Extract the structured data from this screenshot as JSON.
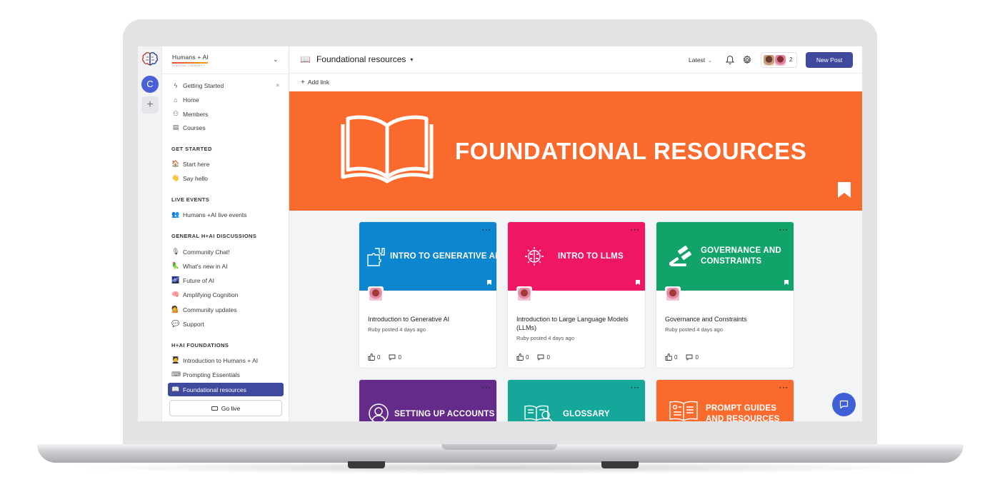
{
  "sidebar": {
    "brand": {
      "name": "Humans + AI",
      "tagline": "LEARNING COMMUNITY"
    },
    "rail": {
      "avatar_letter": "C",
      "add_label": "+"
    },
    "top_items": [
      {
        "label": "Getting Started",
        "icon": "lightning-icon",
        "close": "×"
      },
      {
        "label": "Home",
        "icon": "home-icon"
      },
      {
        "label": "Members",
        "icon": "users-icon"
      },
      {
        "label": "Courses",
        "icon": "book-icon"
      }
    ],
    "sections": [
      {
        "title": "GET STARTED",
        "items": [
          {
            "label": "Start here",
            "emoji": "🏠"
          },
          {
            "label": "Say hello",
            "emoji": "👋"
          }
        ]
      },
      {
        "title": "LIVE EVENTS",
        "items": [
          {
            "label": "Humans +AI live events",
            "emoji": "👥"
          }
        ]
      },
      {
        "title": "GENERAL H+AI DISCUSSIONS",
        "items": [
          {
            "label": "Community Chat!",
            "emoji": "🎙"
          },
          {
            "label": "What's new in AI",
            "emoji": "🦜"
          },
          {
            "label": "Future of AI",
            "emoji": "🌌"
          },
          {
            "label": "Amplifying Cognition",
            "emoji": "🧠"
          },
          {
            "label": "Community updates",
            "emoji": "💁"
          },
          {
            "label": "Support",
            "emoji": "💬"
          }
        ]
      },
      {
        "title": "H+AI FOUNDATIONS",
        "items": [
          {
            "label": "Introduction to Humans + AI",
            "emoji": "🧑‍🎓"
          },
          {
            "label": "Prompting Essentials",
            "emoji": "⌨"
          },
          {
            "label": "Foundational resources",
            "emoji": "📖"
          }
        ]
      }
    ],
    "go_live": "Go live"
  },
  "header": {
    "title": "Foundational resources",
    "title_icon": "📖",
    "sort": "Latest",
    "member_count": "2",
    "new_post": "New Post"
  },
  "linkbar": {
    "add_link": "Add link"
  },
  "banner": {
    "title": "FOUNDATIONAL RESOURCES"
  },
  "cards": [
    {
      "label": "INTRO TO GENERATIVE AI",
      "color": "#0b86cf",
      "title": "Introduction to Generative AI",
      "meta": "Ruby posted 4 days ago",
      "likes": "0",
      "comments": "0"
    },
    {
      "label": "INTRO TO LLMS",
      "color": "#f01663",
      "title": "Introduction to Large Language Models (LLMs)",
      "meta": "Ruby posted 4 days ago",
      "likes": "0",
      "comments": "0"
    },
    {
      "label": "GOVERNANCE AND CONSTRAINTS",
      "color": "#12a36b",
      "title": "Governance and Constraints",
      "meta": "Ruby posted 4 days ago",
      "likes": "0",
      "comments": "0"
    },
    {
      "label": "SETTING UP ACCOUNTS",
      "color": "#652b8a"
    },
    {
      "label": "GLOSSARY",
      "color": "#15a89a"
    },
    {
      "label": "PROMPT GUIDES AND RESOURCES",
      "color": "#fb6a2d"
    }
  ]
}
